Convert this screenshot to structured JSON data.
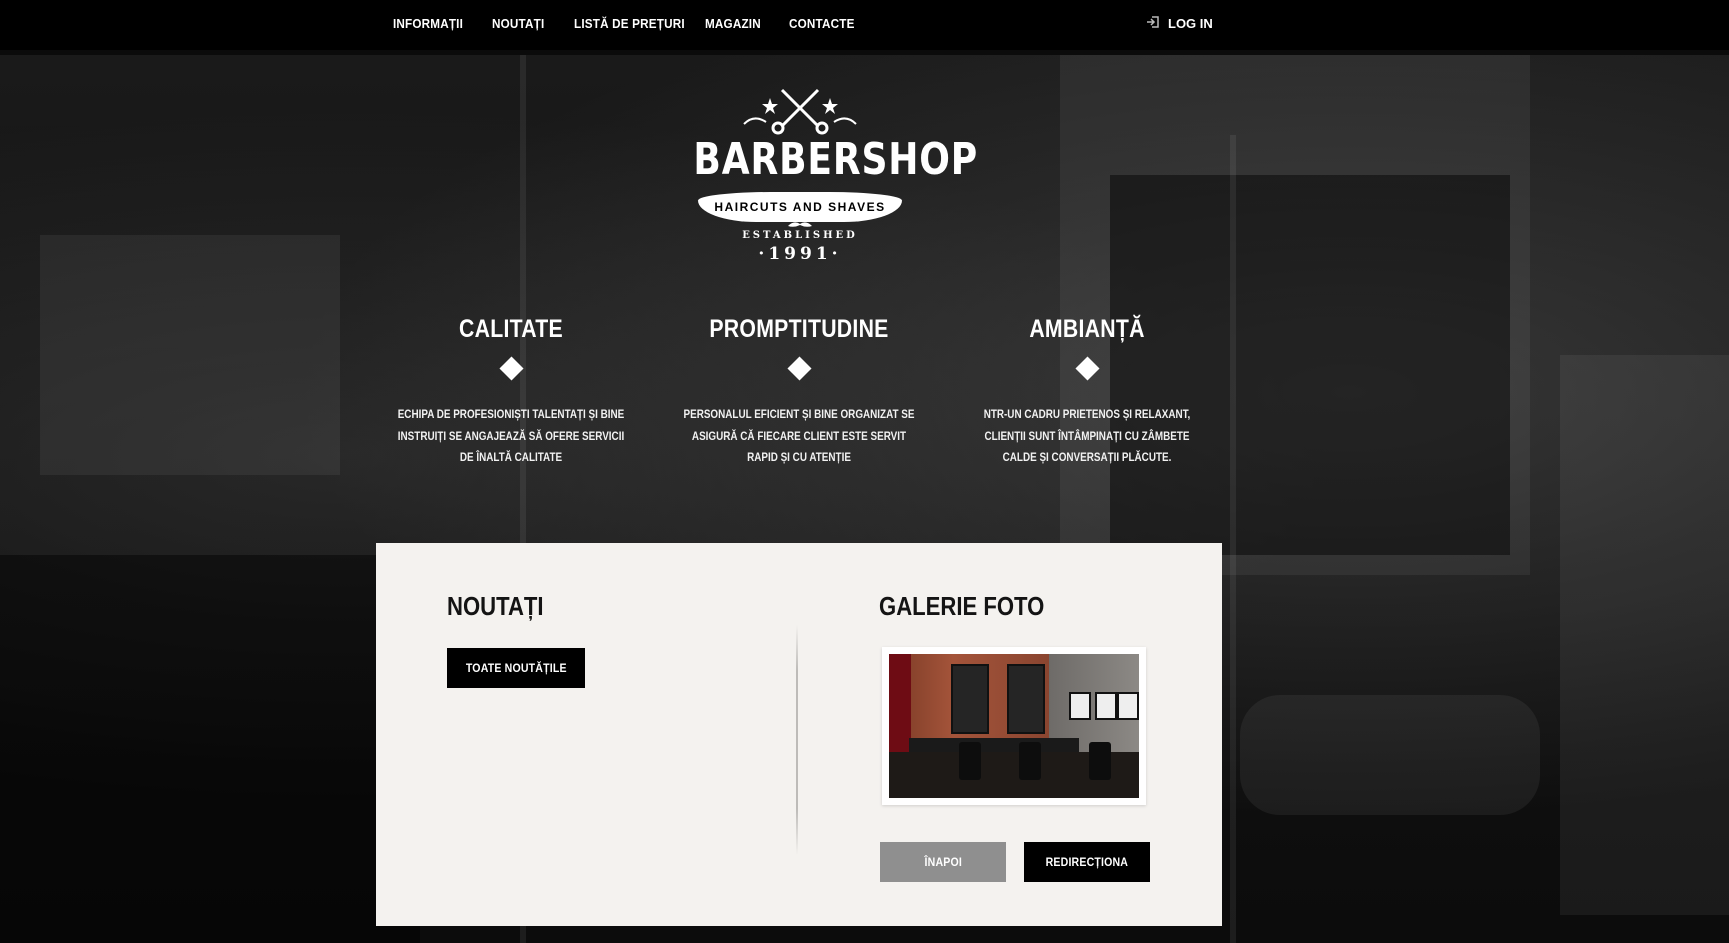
{
  "nav": {
    "items": [
      "INFORMAȚII",
      "NOUTAȚI",
      "LISTĂ DE PREȚURI",
      "MAGAZIN",
      "CONTACTE"
    ],
    "login_label": "LOG IN",
    "login_icon": "login-icon"
  },
  "logo": {
    "title": "BARBERSHOP",
    "ribbon": "HAIRCUTS AND SHAVES",
    "established": "ESTABLISHED",
    "year": "·1991·",
    "icons": [
      "scissors-icon",
      "star-icon",
      "mustache-icon"
    ]
  },
  "features": [
    {
      "title": "CALITATE",
      "text": "ECHIPA DE PROFESIONIȘTI TALENTAȚI ȘI BINE INSTRUIȚI SE ANGAJEAZĂ SĂ OFERE SERVICII DE ÎNALTĂ CALITATE"
    },
    {
      "title": "PROMPTITUDINE",
      "text": "PERSONALUL EFICIENT ȘI BINE ORGANIZAT SE ASIGURĂ CĂ FIECARE CLIENT ESTE SERVIT RAPID ȘI CU ATENȚIE"
    },
    {
      "title": "AMBIANȚĂ",
      "text": "NTR-UN CADRU PRIETENOS ȘI RELAXANT, CLIENȚII SUNT ÎNTÂMPINAȚI CU ZÂMBETE CALDE ȘI CONVERSAȚII PLĂCUTE."
    }
  ],
  "news": {
    "title": "NOUTAȚI",
    "button": "TOATE NOUTĂȚILE"
  },
  "gallery": {
    "title": "GALERIE FOTO",
    "back_button": "ÎNAPOI",
    "redirect_button": "REDIRECȚIONA"
  },
  "colors": {
    "nav_bg": "#000000",
    "content_bg": "#f4f2ef",
    "button_dark": "#000000",
    "button_grey": "#8f8f8f"
  }
}
